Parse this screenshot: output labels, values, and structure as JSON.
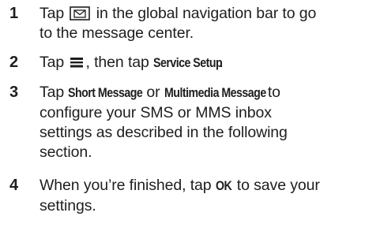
{
  "steps": [
    {
      "number": "1",
      "line1_a": "Tap",
      "line1_b": "in the global navigation bar to go",
      "line2": "to the message center."
    },
    {
      "number": "2",
      "text_a": "Tap",
      "text_b": ", then tap",
      "keyword": "Service Setup",
      "text_end": "."
    },
    {
      "number": "3",
      "text_a": "Tap",
      "keyword1": "Short Message",
      "text_or": "or",
      "keyword2": "Multimedia Message",
      "text_to": "to",
      "line2": "configure your SMS or MMS inbox",
      "line3": "settings as described in the following",
      "line4": "section."
    },
    {
      "number": "4",
      "text_a": "When you’re finished, tap",
      "keyword": "OK",
      "text_b": "to save your",
      "line2": "settings."
    }
  ],
  "icons": {
    "message_center": "envelope-in-box-icon",
    "menu": "menu-icon"
  }
}
